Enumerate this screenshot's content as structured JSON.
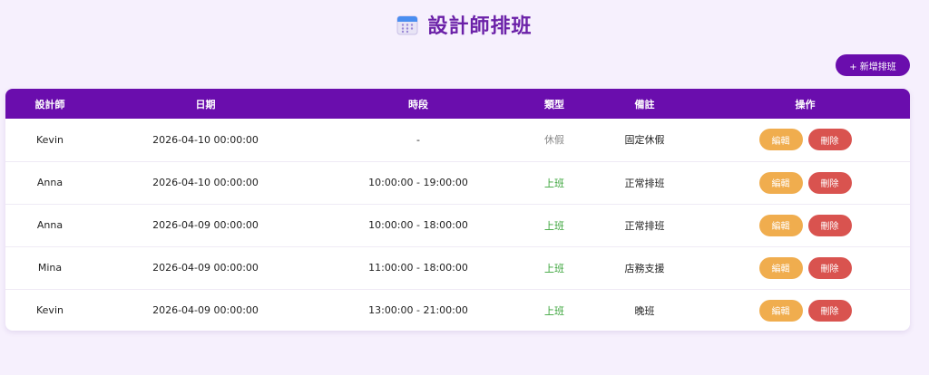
{
  "header": {
    "title": "設計師排班",
    "icon": "calendar-icon"
  },
  "toolbar": {
    "add_label": "+ 新增排班"
  },
  "table": {
    "columns": [
      "設計師",
      "日期",
      "時段",
      "類型",
      "備註",
      "操作"
    ],
    "rows": [
      {
        "designer": "Kevin",
        "date": "2026-04-10 00:00:00",
        "time": "-",
        "type": "休假",
        "note": "固定休假",
        "edit": "編輯",
        "delete": "刪除"
      },
      {
        "designer": "Anna",
        "date": "2026-04-10 00:00:00",
        "time": "10:00:00 - 19:00:00",
        "type": "上班",
        "note": "正常排班",
        "edit": "編輯",
        "delete": "刪除"
      },
      {
        "designer": "Anna",
        "date": "2026-04-09 00:00:00",
        "time": "10:00:00 - 18:00:00",
        "type": "上班",
        "note": "正常排班",
        "edit": "編輯",
        "delete": "刪除"
      },
      {
        "designer": "Mina",
        "date": "2026-04-09 00:00:00",
        "time": "11:00:00 - 18:00:00",
        "type": "上班",
        "note": "店務支援",
        "edit": "編輯",
        "delete": "刪除"
      },
      {
        "designer": "Kevin",
        "date": "2026-04-09 00:00:00",
        "time": "13:00:00 - 21:00:00",
        "type": "上班",
        "note": "晚班",
        "edit": "編輯",
        "delete": "刪除"
      }
    ]
  },
  "colors": {
    "primary": "#6a0dad",
    "background": "#f6f0fd",
    "edit": "#f0ad4e",
    "delete": "#d9534f",
    "type_on": "#3aa43a",
    "type_off": "#888888"
  }
}
